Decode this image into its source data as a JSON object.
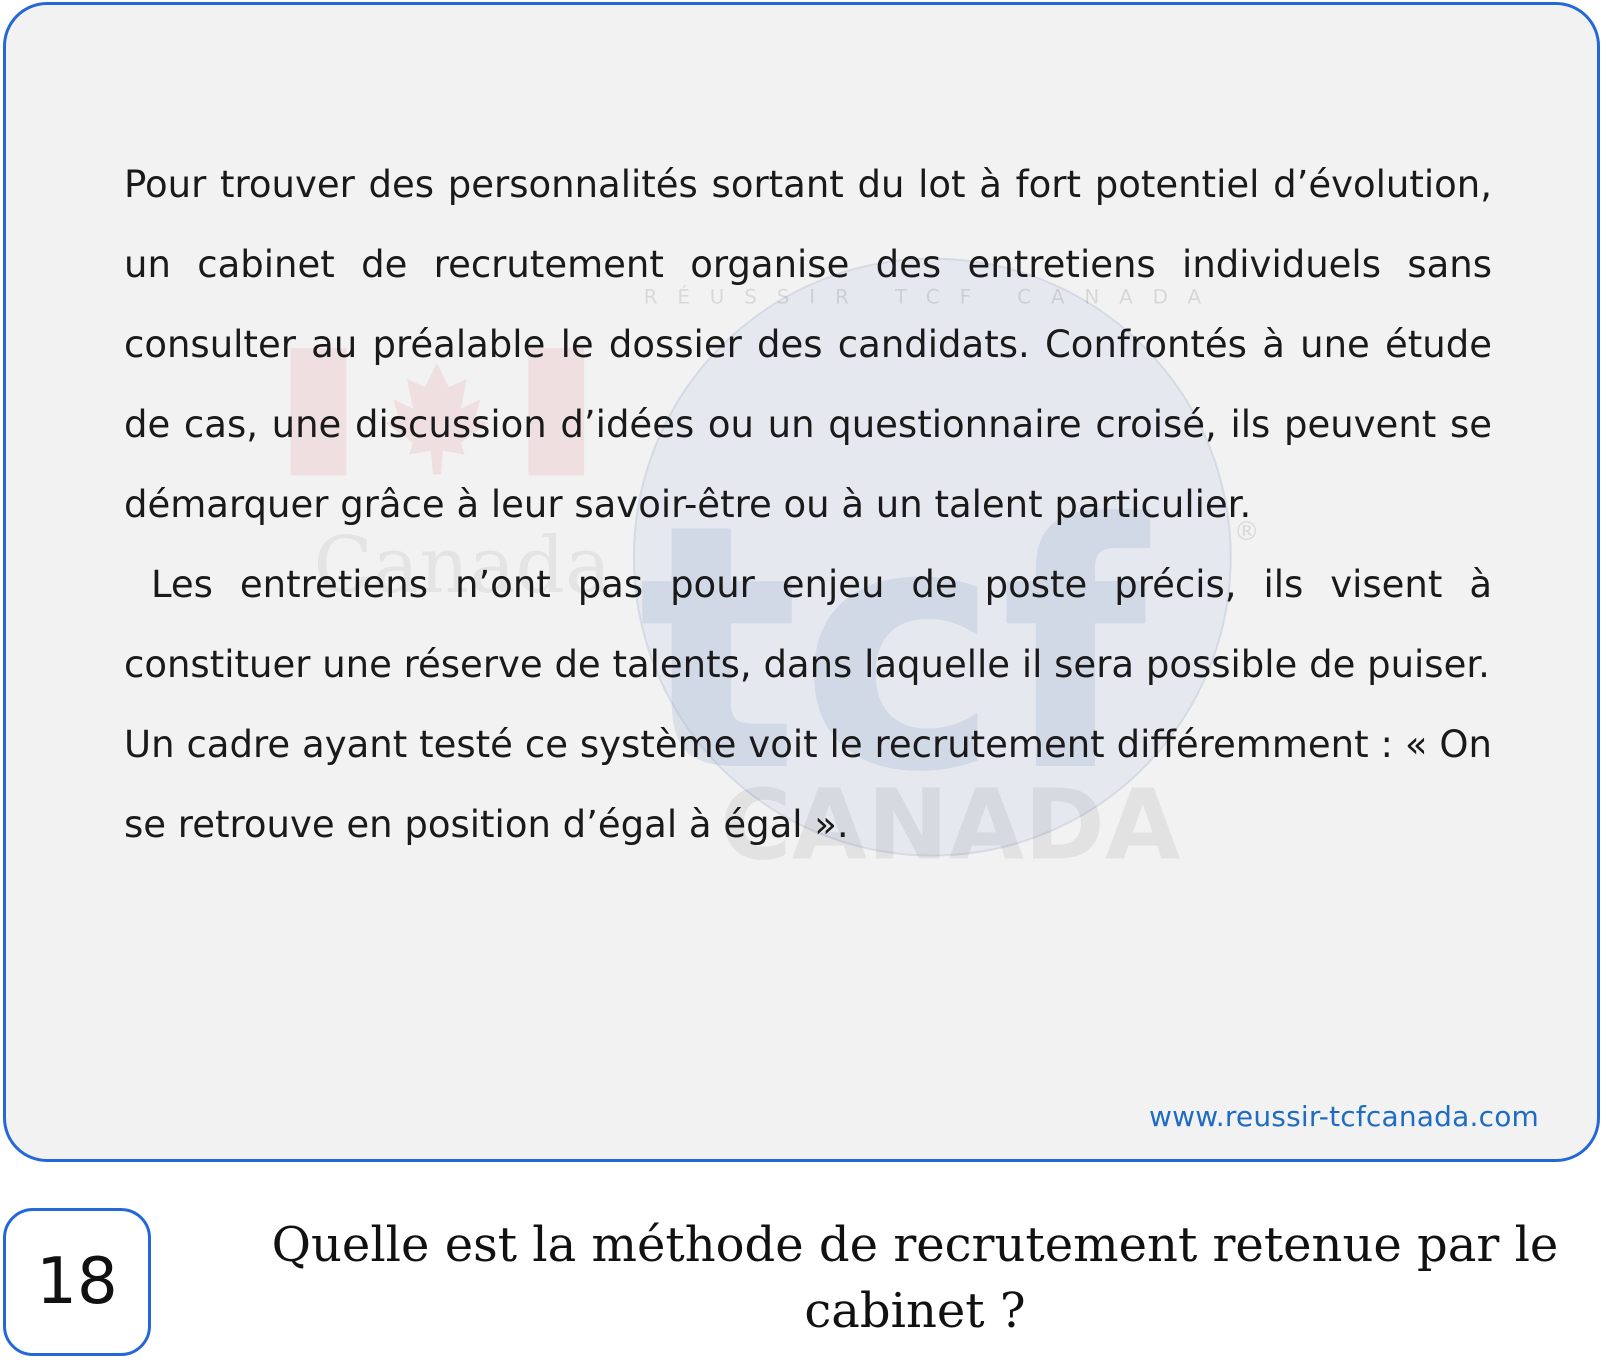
{
  "passage": {
    "paragraphs": [
      "Pour trouver des personnalités sortant du lot à fort potentiel d’évolution, un cabinet de recrutement organise des entretiens individuels sans consulter au préalable le dossier des candidats. Confrontés à une étude de cas, une discussion d’idées ou un questionnaire croisé, ils peuvent se démarquer grâce à leur savoir-être ou à un talent particulier.",
      " Les entretiens n’ont pas pour enjeu de poste précis, ils visent à constituer une réserve de talents, dans laquelle il sera possible de puiser.",
      "Un cadre ayant testé ce système voit le recrutement différemment : « On se retrouve en position d’égal à égal »."
    ],
    "source_url": "www.reussir-tcfcanada.com"
  },
  "watermark": {
    "logo_text": "tcf",
    "country_text": "CANADA",
    "brand_text": "Canada",
    "ring_text": "RÉUSSIR TCF CANADA",
    "registered_mark": "®"
  },
  "question": {
    "number": "18",
    "text": "Quelle est la méthode de recrutement retenue par le cabinet ?"
  },
  "colors": {
    "accent": "#2468d8",
    "link": "#1f6cc0",
    "card_background": "#f2f2f2",
    "watermark_red": "#d9242a"
  }
}
